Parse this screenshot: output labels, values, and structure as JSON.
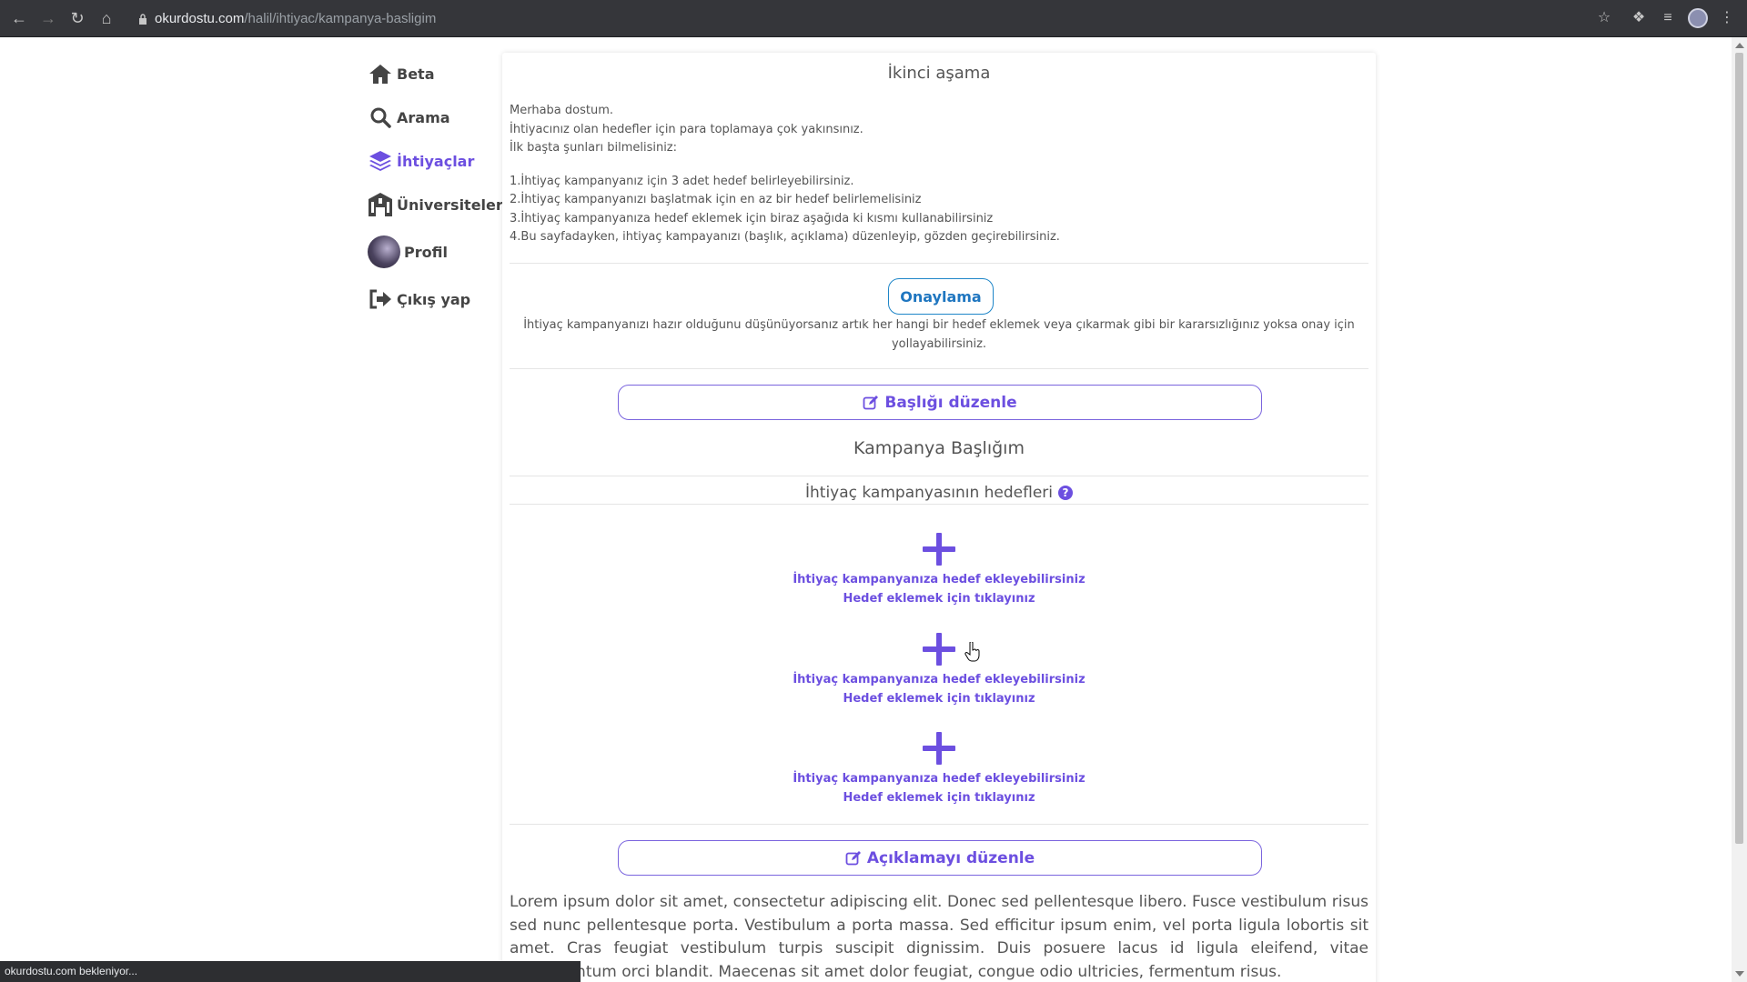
{
  "browser": {
    "url_host": "okurdostu.com",
    "url_path": "/halil/ihtiyac/kampanya-basligim"
  },
  "sidebar": {
    "items": [
      {
        "label": "Beta",
        "icon": "home-icon"
      },
      {
        "label": "Arama",
        "icon": "search-icon"
      },
      {
        "label": "İhtiyaçlar",
        "icon": "layers-icon",
        "active": true
      },
      {
        "label": "Üniversiteler",
        "icon": "university-icon"
      },
      {
        "label": "Profil",
        "icon": "avatar"
      },
      {
        "label": "Çıkış yap",
        "icon": "sign-out-icon"
      }
    ]
  },
  "main": {
    "stage_title": "İkinci aşama",
    "intro_lines": [
      "Merhaba dostum.",
      "İhtiyacınız olan hedefler için para toplamaya çok yakınsınız.",
      "İlk başta şunları bilmelisiniz:"
    ],
    "rules": [
      "1.İhtiyaç kampanyanız için 3 adet hedef belirleyebilirsiniz.",
      "2.İhtiyaç kampanyanızı başlatmak için en az bir hedef belirlemelisiniz",
      "3.İhtiyaç kampanyanıza hedef eklemek için biraz aşağıda ki kısmı kullanabilirsiniz",
      "4.Bu sayfadayken, ihtiyaç kampayanızı (başlık, açıklama) düzenleyip, gözden geçirebilirsiniz."
    ],
    "confirm_button": "Onaylama",
    "confirm_text": "İhtiyaç kampanyanızı hazır olduğunu düşünüyorsanız artık her hangi bir hedef eklemek veya çıkarmak gibi bir kararsızlığınız yoksa onay için yollayabilirsiniz.",
    "edit_title_button": "Başlığı düzenle",
    "campaign_title": "Kampanya Başlığım",
    "targets_title": "İhtiyaç kampanyasının hedefleri",
    "help_icon_glyph": "?",
    "targets": [
      {
        "line1": "İhtiyaç kampanyanıza hedef ekleyebilirsiniz",
        "line2": "Hedef eklemek için tıklayınız"
      },
      {
        "line1": "İhtiyaç kampanyanıza hedef ekleyebilirsiniz",
        "line2": "Hedef eklemek için tıklayınız"
      },
      {
        "line1": "İhtiyaç kampanyanıza hedef ekleyebilirsiniz",
        "line2": "Hedef eklemek için tıklayınız"
      }
    ],
    "edit_description_button": "Açıklamayı düzenle",
    "description": "Lorem ipsum dolor sit amet, consectetur adipiscing elit. Donec sed pellentesque libero. Fusce vestibulum risus sed nunc pellentesque porta. Vestibulum a porta massa. Sed efficitur ipsum enim, vel porta ligula lobortis sit amet. Cras feugiat vestibulum turpis suscipit dignissim. Duis posuere lacus id ligula eleifend, vitae condimentum orci blandit. Maecenas sit amet dolor feugiat, congue odio ultricies, fermentum risus."
  },
  "status_bar": "okurdostu.com bekleniyor...",
  "colors": {
    "accent": "#6c4fe0",
    "confirm_blue": "#1f76c0",
    "text": "#555555",
    "chrome": "#35363a"
  }
}
